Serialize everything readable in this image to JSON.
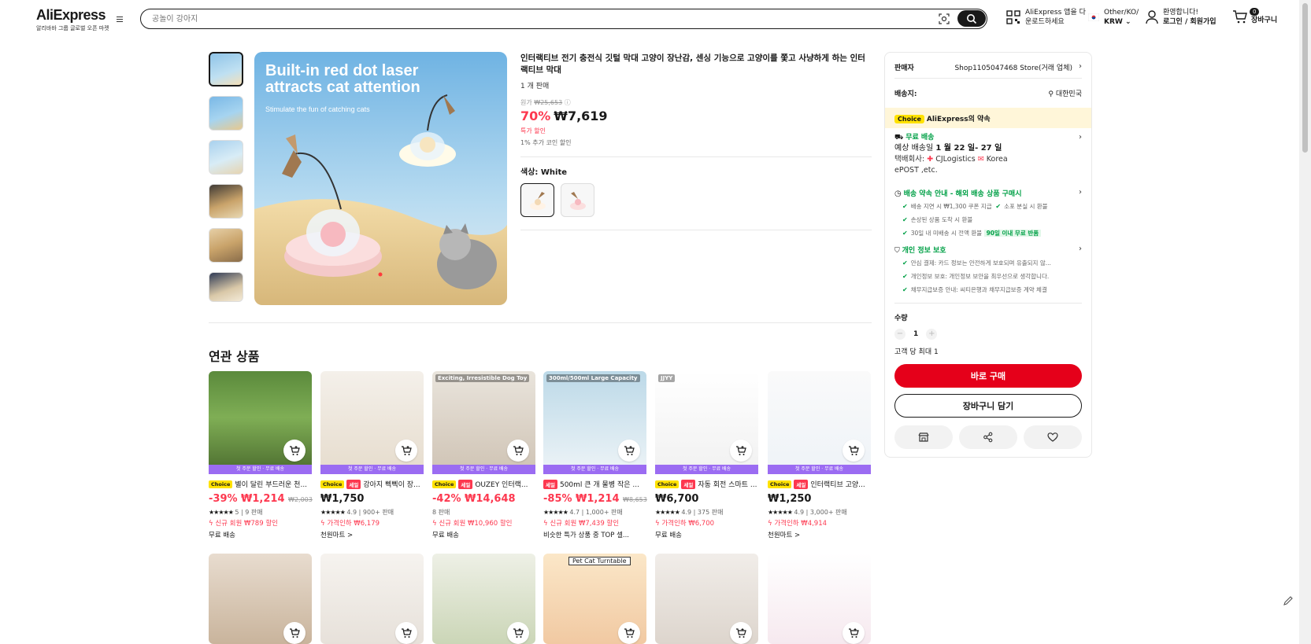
{
  "header": {
    "logo": "AliExpress",
    "logo_sub": "알리바바 그룹 글로벌 오픈 마켓",
    "search_placeholder": "공놀이 강아지",
    "app_line1": "AliExpress 앱을 다",
    "app_line2": "운로드하세요",
    "lang_line1": "Other/KO/",
    "lang_line2": "KRW",
    "user_line1": "환영합니다!",
    "user_line2": "로그인 / 회원가입",
    "cart_count": "0",
    "cart_label": "장바구니"
  },
  "product": {
    "image_title_1": "Built-in red dot laser",
    "image_title_2": "attracts cat attention",
    "image_subtitle": "Stimulate the fun of catching cats",
    "title": "인터랙티브 전기 충전식 깃털 막대 고양이 장난감, 센싱 기능으로 고양이를 쫓고 사냥하게 하는 인터랙티브 막대",
    "sold": "1 개 판매",
    "original_label": "원가",
    "original_price": "₩25,653",
    "discount": "70%",
    "price": "₩7,619",
    "special": "특가 할인",
    "coin": "1% 추가 코인 할인",
    "color_label": "색상: White"
  },
  "panel": {
    "seller_label": "판매자",
    "seller_value": "Shop1105047468 Store(거래 업체)",
    "ship_to_label": "배송지:",
    "ship_to_value": "대한민국",
    "choice_tag": "Choice",
    "choice_text": "AliExpress의 약속",
    "free_ship": "무료 배송",
    "eta_prefix": "예상 배송일 ",
    "eta_value": "1 월 22 일- 27 일",
    "courier_label": "택배회사:",
    "courier_value_1": "CJLogistics",
    "courier_value_2": "Korea",
    "courier_value_3": "ePOST ,etc.",
    "promise_title": "배송 약속 안내 - 해외 배송 상품 구매시",
    "promise_1": "배송 지연 시 ₩1,300 쿠폰 지급",
    "promise_2": "소포 분실 시 환불",
    "promise_3": "손상된 상품 도착 시 환불",
    "promise_4": "30일 내 미배송 시 전액 환불",
    "promise_badge": "90일 이내 무료 반품",
    "privacy_title": "개인 정보 보호",
    "privacy_1": "안심 결제: 카드 정보는 안전하게 보호되며 유출되지 않...",
    "privacy_2": "개인정보 보호: 개인정보 보안을 최우선으로 생각합니다.",
    "privacy_3": "채무지급보증 안내: 씨티은행과 채무지급보증 계약 체결",
    "qty_label": "수량",
    "qty_value": "1",
    "qty_limit": "고객 당 최대 1",
    "buy_now": "바로 구매",
    "add_cart": "장바구니 담기"
  },
  "related": {
    "title": "연관 상품",
    "ribbon": "첫 주문 할인 · 무료 배송",
    "cards": [
      {
        "title": "별이 달린 부드러운 천...",
        "choice": "Choice",
        "sale": "",
        "discount": "-39%",
        "price": "₩1,214",
        "orig": "₩2,003",
        "stars": "★★★★★",
        "rating": "5 | 9 판매",
        "promo": "신규 회원 ₩789 할인",
        "ship": "무료 배송"
      },
      {
        "title": "강아지 삑삑이 장...",
        "choice": "Choice",
        "sale": "세일",
        "discount": "",
        "price": "₩1,750",
        "orig": "",
        "stars": "★★★★★",
        "rating": "4.9 | 900+ 판매",
        "promo": "가격인하 ₩6,179",
        "ship": "천원마트 >"
      },
      {
        "title": "OUZEY 인터랙...",
        "choice": "Choice",
        "sale": "세일",
        "discount": "-42%",
        "price": "₩14,648",
        "orig": "",
        "stars": "",
        "rating": "8 판매",
        "promo": "신규 회원 ₩10,960 할인",
        "ship": "무료 배송"
      },
      {
        "title": "500ml 큰 개 물병 작은 ...",
        "choice": "",
        "sale": "세일",
        "discount": "-85%",
        "price": "₩1,214",
        "orig": "₩8,653",
        "stars": "★★★★★",
        "rating": "4.7 | 1,000+ 판매",
        "promo": "신규 회원 ₩7,439 할인",
        "ship": "비슷한 특가 상품 중 TOP 셀..."
      },
      {
        "title": "자동 회전 스마트 ...",
        "choice": "Choice",
        "sale": "세일",
        "discount": "",
        "price": "₩6,700",
        "orig": "",
        "stars": "★★★★★",
        "rating": "4.9 | 375 판매",
        "promo": "가격인하 ₩6,700",
        "ship": "무료 배송"
      },
      {
        "title": "인터랙티브 고양...",
        "choice": "Choice",
        "sale": "세일",
        "discount": "",
        "price": "₩1,250",
        "orig": "",
        "stars": "★★★★★",
        "rating": "4.9 | 3,000+ 판매",
        "promo": "가격인하 ₩4,914",
        "ship": "천원마트 >"
      }
    ],
    "row2_labels": [
      "",
      "",
      "",
      "Pet Cat Turntable",
      "",
      ""
    ],
    "card_img_labels": [
      "",
      "",
      "Exciting, Irresistible Dog Toy",
      "300ml/500ml Large Capacity",
      "JJYY",
      ""
    ]
  },
  "colors": {
    "accent_red": "#fd384f",
    "buy_red": "#e5001a",
    "choice_yellow": "#ffe200",
    "green": "#00a046",
    "ribbon_purple": "#9b6cf2"
  }
}
